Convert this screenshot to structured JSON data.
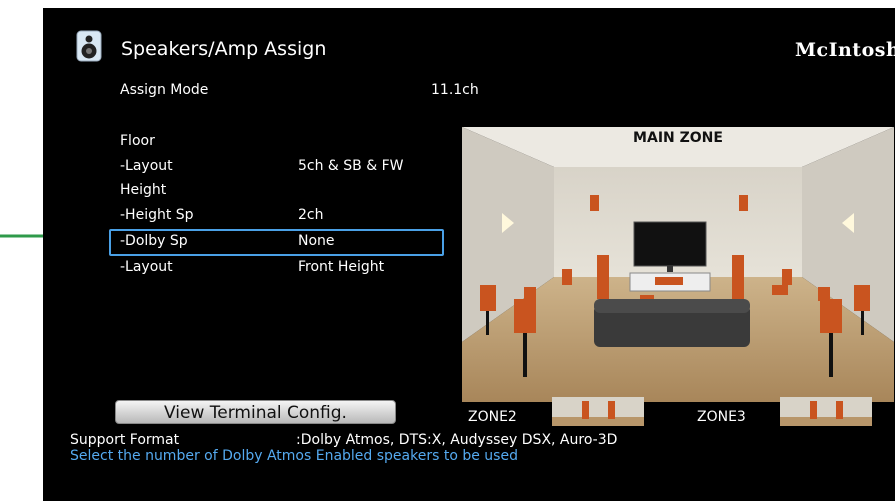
{
  "header": {
    "title": "Speakers/Amp Assign",
    "brand": "McIntosh",
    "icon": "speaker-icon"
  },
  "settings": [
    {
      "label": "Assign Mode",
      "value": "11.1ch"
    },
    {
      "label": "Floor",
      "value": ""
    },
    {
      "label": "-Layout",
      "value": "5ch & SB & FW"
    },
    {
      "label": "Height",
      "value": ""
    },
    {
      "label": "-Height Sp",
      "value": "2ch"
    },
    {
      "label": "-Dolby Sp",
      "value": "None",
      "selected": true
    },
    {
      "label": "-Layout",
      "value": "Front Height"
    }
  ],
  "preview": {
    "main_zone_label": "MAIN ZONE",
    "zone2_label": "ZONE2",
    "zone3_label": "ZONE3"
  },
  "view_terminal_button": "View Terminal Config.",
  "support_format": {
    "label": "Support Format",
    "value": ":Dolby Atmos, DTS:X, Audyssey DSX, Auro-3D"
  },
  "hint": "Select the number of Dolby Atmos Enabled speakers to be used",
  "colors": {
    "highlight": "#4aa0e6",
    "hint_text": "#55aaf0",
    "pointer_arrow": "#2e9a4a",
    "speaker_orange": "#c9541f"
  }
}
